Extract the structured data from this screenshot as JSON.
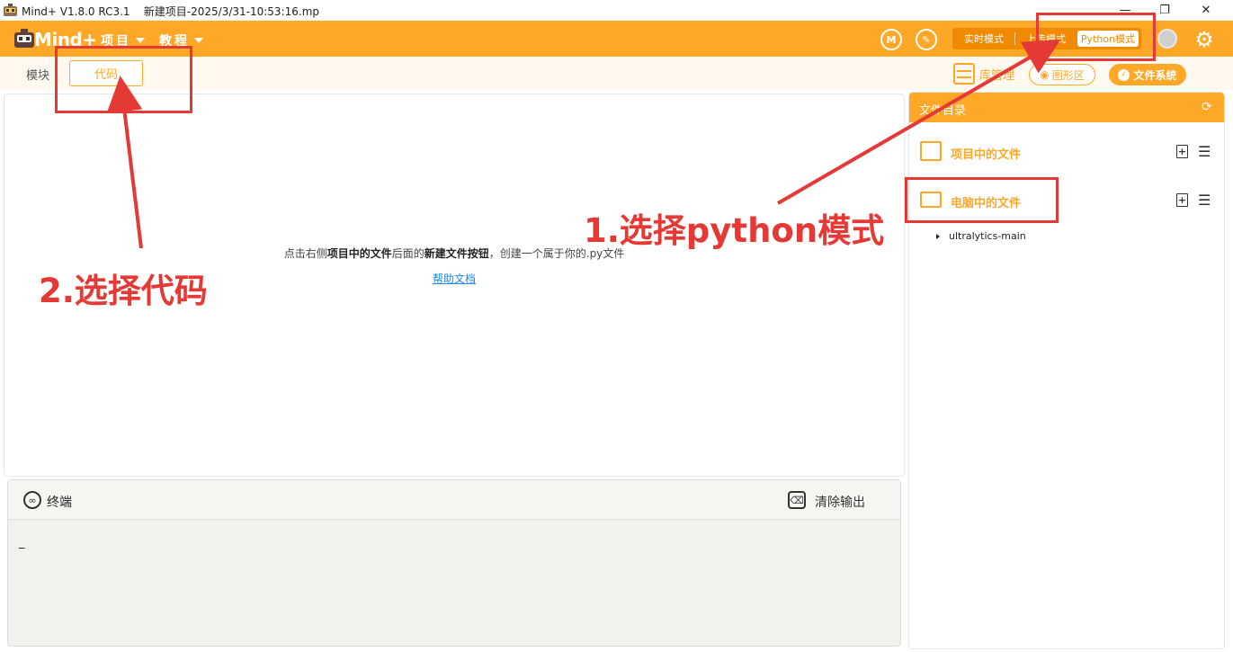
{
  "window": {
    "title": "Mind+ V1.8.0 RC3.1    新建项目-2025/3/31-10:53:16.mp",
    "minimize": "—",
    "restore": "❐",
    "close": "✕"
  },
  "menubar": {
    "logo": "Mind+",
    "menus": [
      {
        "label": "项目"
      },
      {
        "label": "教程"
      }
    ],
    "modes": {
      "realtime": "实时模式",
      "upload": "上传模式",
      "python": "Python模式"
    }
  },
  "tabs": {
    "blocks": "模块",
    "code": "代码"
  },
  "toolbar": {
    "library": "库管理",
    "graph_area": "图形区",
    "file_system": "文件系统"
  },
  "editor": {
    "hint_parts": [
      "点击右侧",
      "项目中的文件",
      "后面的",
      "新建文件按钮",
      "，创建一个属于你的.py文件"
    ],
    "help_link": "帮助文档"
  },
  "terminal": {
    "label": "终端",
    "clear": "清除输出",
    "cursor": "_"
  },
  "file_panel": {
    "title": "文件目录",
    "sections": [
      {
        "label": "项目中的文件"
      },
      {
        "label": "电脑中的文件"
      }
    ],
    "tree": [
      {
        "name": "ultralytics-main"
      }
    ]
  },
  "annotations": {
    "step1": "1.选择python模式",
    "step2": "2.选择代码"
  },
  "colors": {
    "accent": "#ffa726",
    "annotation": "#e53935"
  }
}
